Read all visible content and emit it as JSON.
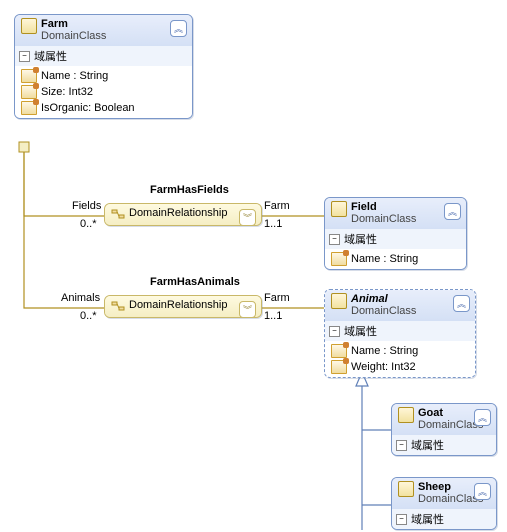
{
  "farm": {
    "title": "Farm",
    "subtitle": "DomainClass",
    "sect": "域属性",
    "props": [
      {
        "n": "Name : String"
      },
      {
        "n": "Size: Int32"
      },
      {
        "n": "IsOrganic: Boolean"
      }
    ]
  },
  "field": {
    "title": "Field",
    "subtitle": "DomainClass",
    "sect": "域属性",
    "props": [
      {
        "n": "Name : String"
      }
    ]
  },
  "animal": {
    "title": "Animal",
    "subtitle": "DomainClass",
    "sect": "域属性",
    "props": [
      {
        "n": "Name : String"
      },
      {
        "n": "Weight: Int32"
      }
    ]
  },
  "goat": {
    "title": "Goat",
    "subtitle": "DomainClass",
    "sect": "域属性"
  },
  "sheep": {
    "title": "Sheep",
    "subtitle": "DomainClass",
    "sect": "域属性"
  },
  "rel1": {
    "title": "FarmHasFields",
    "body": "DomainRelationship",
    "left_role": "Fields",
    "left_mult": "0..*",
    "right_role": "Farm",
    "right_mult": "1..1"
  },
  "rel2": {
    "title": "FarmHasAnimals",
    "body": "DomainRelationship",
    "left_role": "Animals",
    "left_mult": "0..*",
    "right_role": "Farm",
    "right_mult": "1..1"
  }
}
